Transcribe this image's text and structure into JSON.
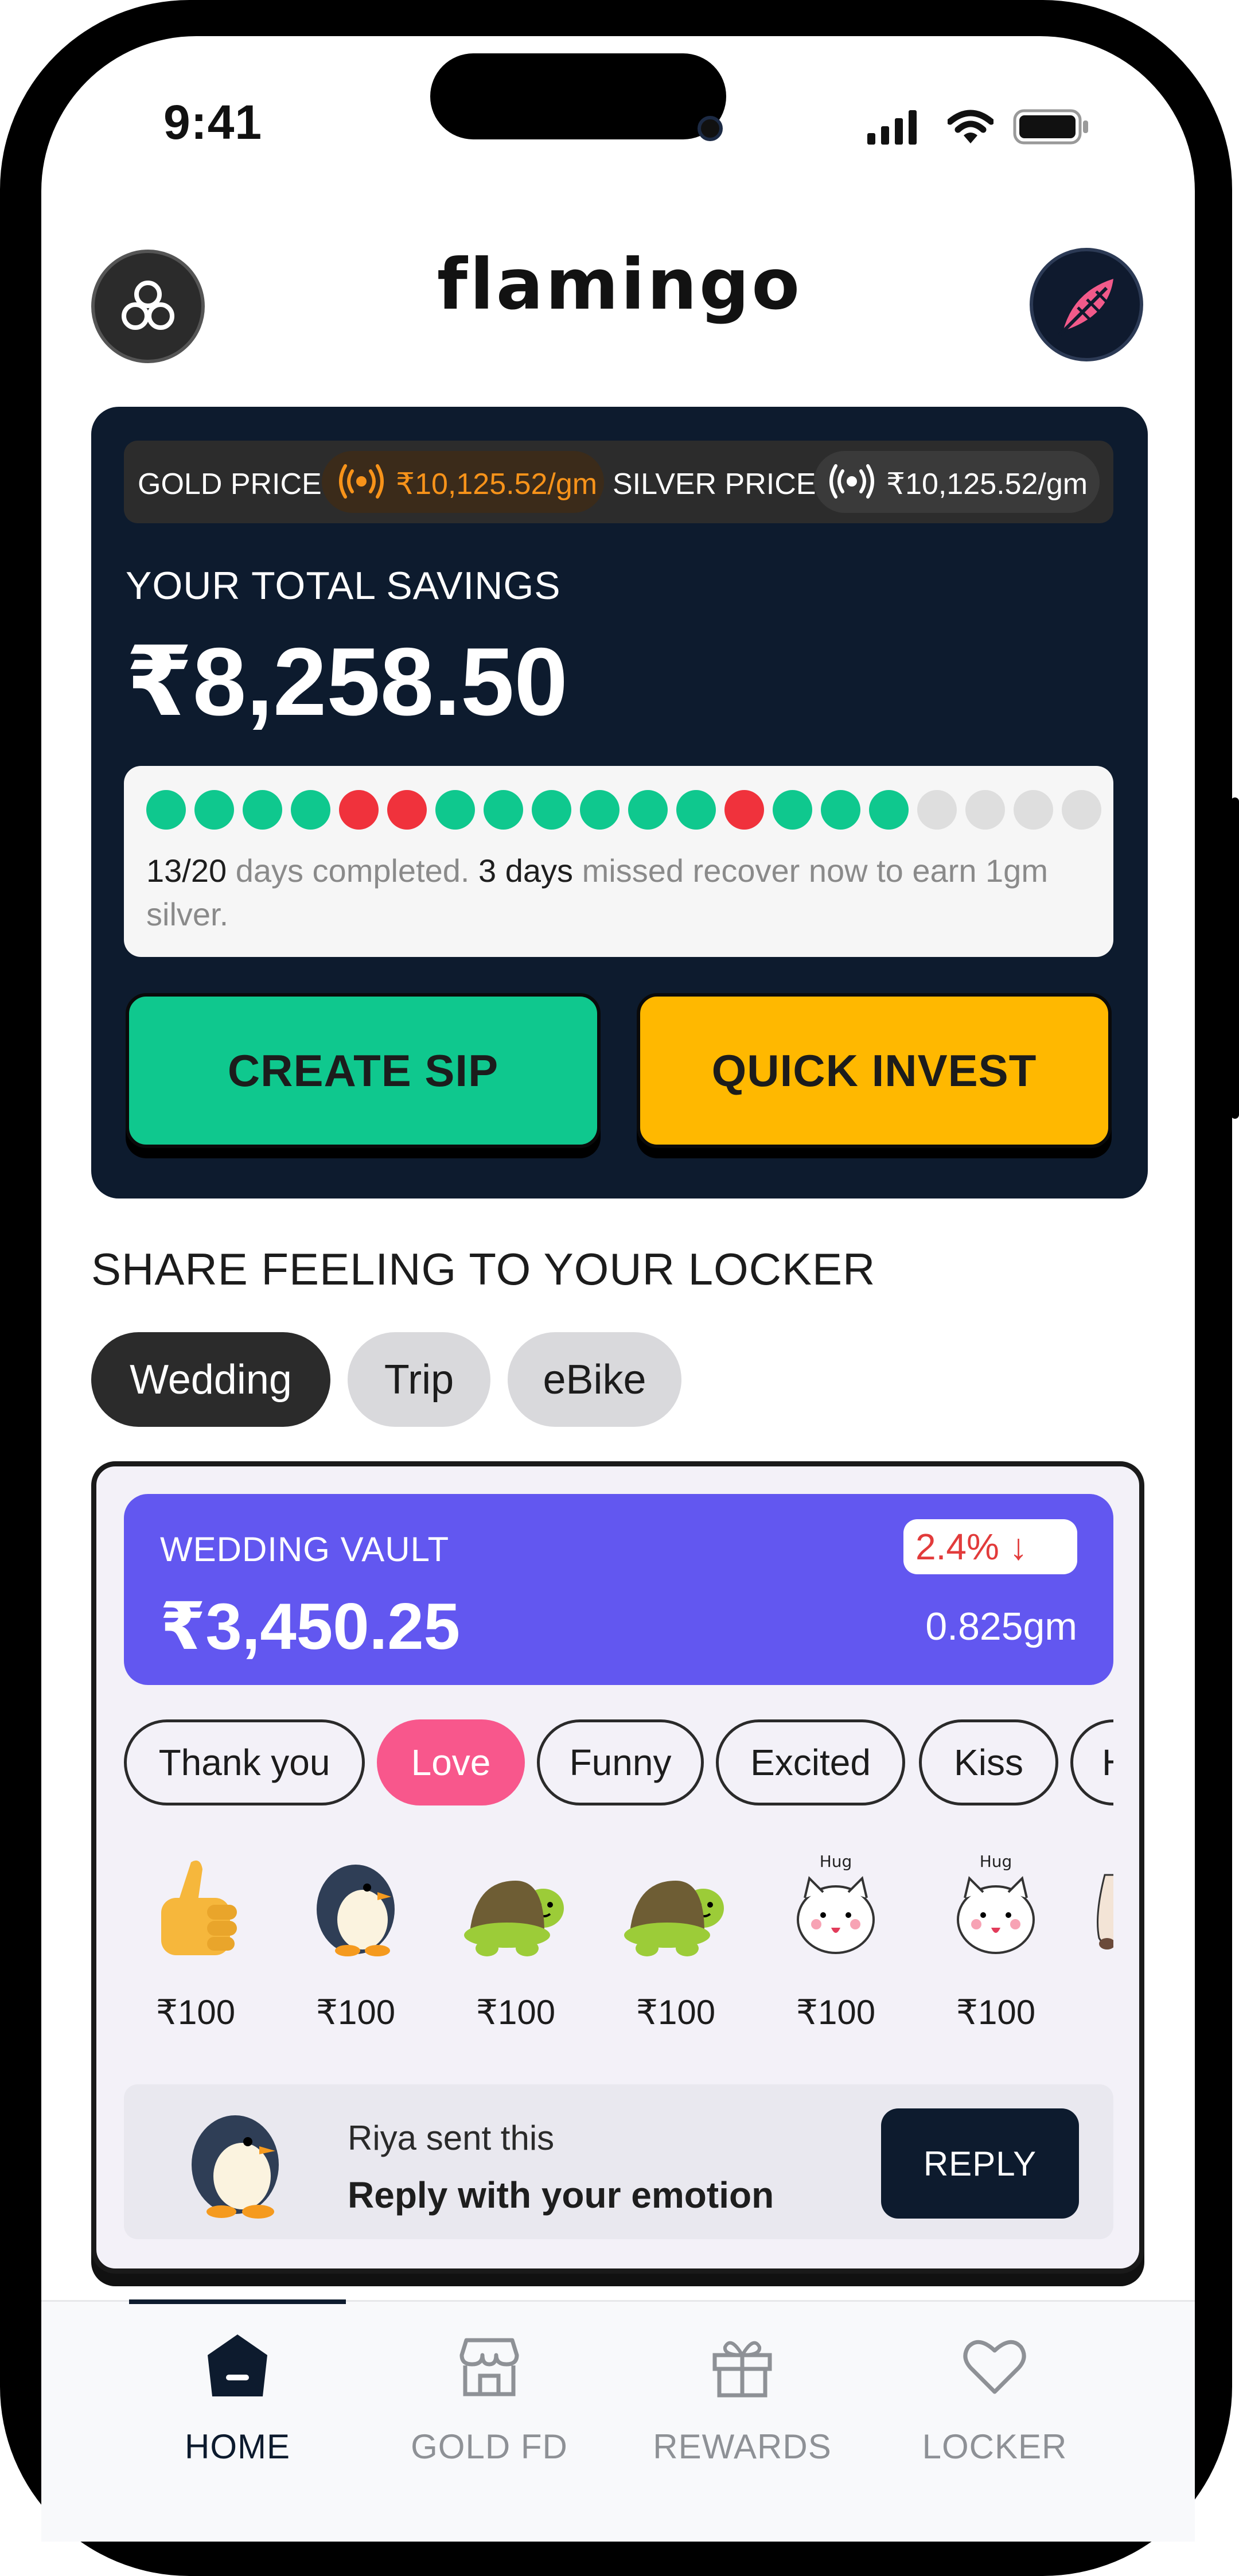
{
  "status_bar": {
    "time": "9:41"
  },
  "header": {
    "logo": "flamingo"
  },
  "prices": {
    "gold_label": "GOLD PRICE:",
    "gold_value": "₹10,125.52/gm",
    "silver_label": "SILVER PRICE:",
    "silver_value": "₹10,125.52/gm"
  },
  "savings": {
    "label": "YOUR TOTAL SAVINGS",
    "amount": "₹8,258.50"
  },
  "streak": {
    "days": [
      "done",
      "done",
      "done",
      "done",
      "missed",
      "missed",
      "done",
      "done",
      "done",
      "done",
      "done",
      "done",
      "missed",
      "done",
      "done",
      "done",
      "pending",
      "pending",
      "pending",
      "pending"
    ],
    "completed": "13/20",
    "completed_suffix": " days completed. ",
    "missed": "3 days",
    "missed_suffix": " missed recover now to earn 1gm silver."
  },
  "actions": {
    "create_sip": "CREATE SIP",
    "quick_invest": "QUICK INVEST"
  },
  "share": {
    "title": "SHARE FEELING TO YOUR LOCKER",
    "lockers": [
      "Wedding",
      "Trip",
      "eBike"
    ],
    "selected_locker": "Wedding"
  },
  "vault": {
    "name": "WEDDING VAULT",
    "amount": "₹3,450.25",
    "change": "2.4% ↓",
    "weight": "0.825gm",
    "emotions": [
      "Thank you",
      "Love",
      "Funny",
      "Excited",
      "Kiss",
      "Hug"
    ],
    "selected_emotion": "Love",
    "stickers": [
      {
        "icon": "thumbs-up-sticker",
        "price": "₹100"
      },
      {
        "icon": "penguin-sticker",
        "price": "₹100"
      },
      {
        "icon": "turtle-sticker",
        "price": "₹100"
      },
      {
        "icon": "turtle-sticker",
        "price": "₹100"
      },
      {
        "icon": "hug-cat-sticker",
        "price": "₹100",
        "caption": "Hug"
      },
      {
        "icon": "hug-cat-sticker",
        "price": "₹100",
        "caption": "Hug"
      }
    ],
    "reply": {
      "sender": "Riya sent this",
      "prompt": "Reply with your emotion",
      "button": "REPLY"
    }
  },
  "bottom_nav": {
    "items": [
      {
        "label": "HOME",
        "icon": "home-icon",
        "active": true
      },
      {
        "label": "GOLD FD",
        "icon": "store-icon",
        "active": false
      },
      {
        "label": "REWARDS",
        "icon": "gift-icon",
        "active": false
      },
      {
        "label": "LOCKER",
        "icon": "heart-icon",
        "active": false
      }
    ]
  },
  "colors": {
    "card_dark": "#0d1b2e",
    "success": "#0fc88e",
    "warning": "#ffb800",
    "missed": "#f0323c",
    "vault_purple": "#6257f0",
    "love_pink": "#f8578c",
    "gold_text": "#f7931a"
  }
}
